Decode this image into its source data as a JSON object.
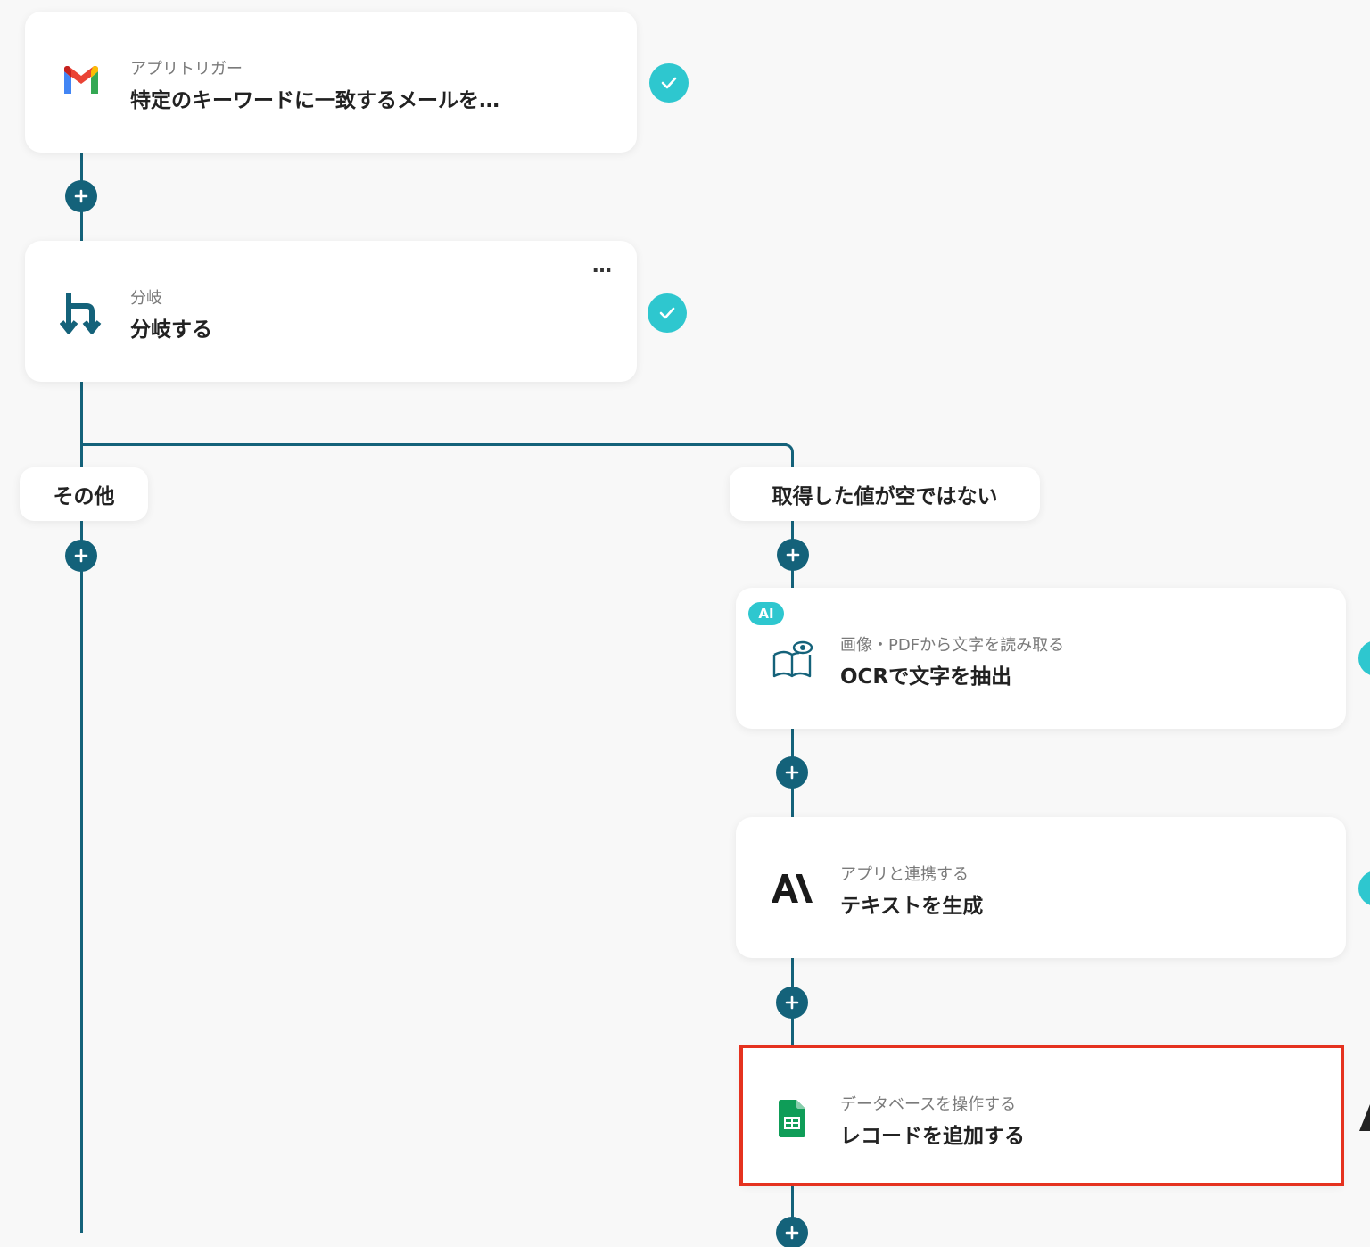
{
  "nodes": {
    "trigger": {
      "subtitle": "アプリトリガー",
      "title": "特定のキーワードに一致するメールを…",
      "icon": "gmail-icon"
    },
    "branch": {
      "subtitle": "分岐",
      "title": "分岐する",
      "icon": "branch-icon",
      "more": "…"
    },
    "ocr": {
      "badge": "AI",
      "subtitle": "画像・PDFから文字を読み取る",
      "title": "OCRで文字を抽出",
      "icon": "book-eye-icon"
    },
    "generate": {
      "subtitle": "アプリと連携する",
      "title": "テキストを生成",
      "icon": "anthropic-icon"
    },
    "sheets": {
      "subtitle": "データベースを操作する",
      "title": "レコードを追加する",
      "icon": "google-sheets-icon"
    }
  },
  "branches": {
    "other": "その他",
    "not_empty": "取得した値が空ではない"
  },
  "colors": {
    "line": "#14627a",
    "check": "#2ec7cf",
    "highlight": "#e5321f",
    "background": "#f8f8f8"
  }
}
